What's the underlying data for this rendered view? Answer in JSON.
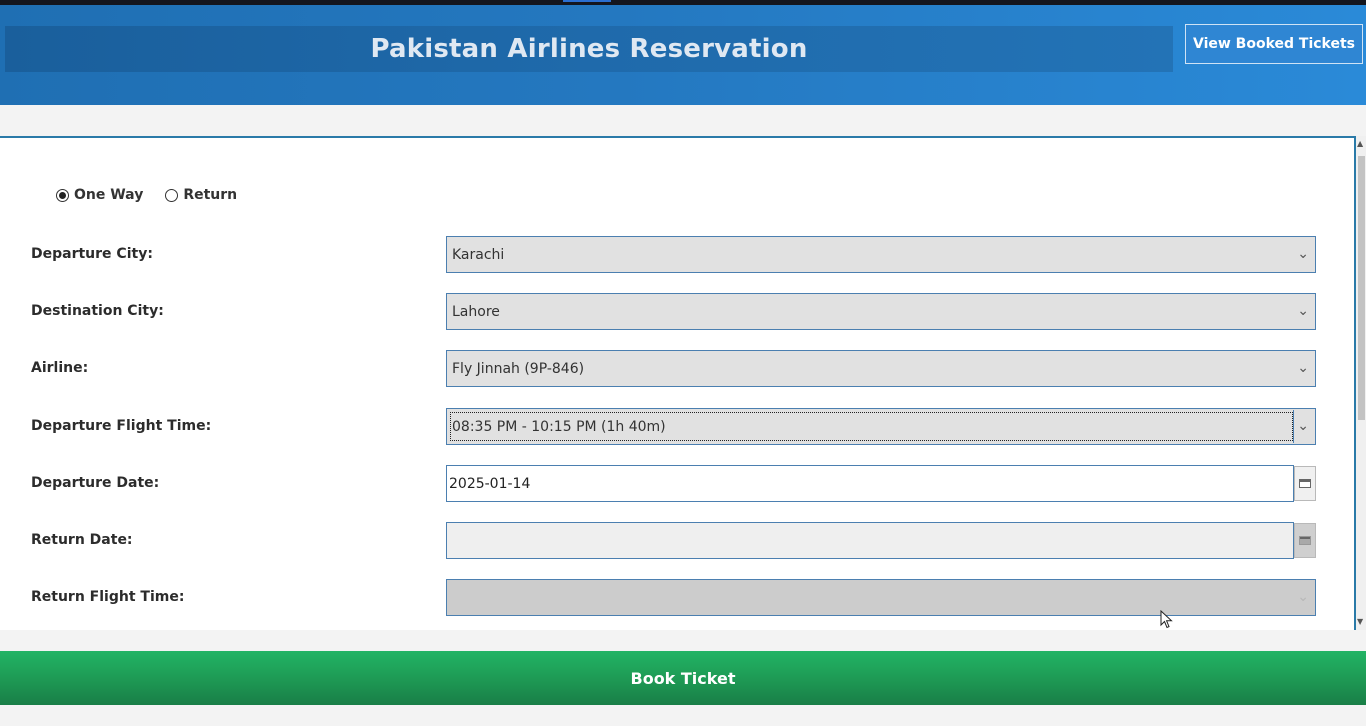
{
  "header": {
    "title": "Pakistan Airlines Reservation",
    "view_button": "View Booked Tickets"
  },
  "trip_type": {
    "options": [
      {
        "label": "One Way",
        "selected": true
      },
      {
        "label": "Return",
        "selected": false
      }
    ]
  },
  "form": {
    "departure_city": {
      "label": "Departure City:",
      "value": "Karachi"
    },
    "destination_city": {
      "label": "Destination City:",
      "value": "Lahore"
    },
    "airline": {
      "label": "Airline:",
      "value": "Fly Jinnah (9P-846)"
    },
    "departure_flight_time": {
      "label": "Departure Flight Time:",
      "value": "08:35 PM - 10:15 PM (1h 40m)"
    },
    "departure_date": {
      "label": "Departure Date:",
      "value": "2025-01-14"
    },
    "return_date": {
      "label": "Return Date:",
      "value": ""
    },
    "return_flight_time": {
      "label": "Return Flight Time:",
      "value": ""
    }
  },
  "actions": {
    "book_label": "Book Ticket"
  },
  "colors": {
    "header_blue": "#2478c0",
    "book_green": "#1e9b55",
    "panel_border": "#2a7aa8"
  }
}
